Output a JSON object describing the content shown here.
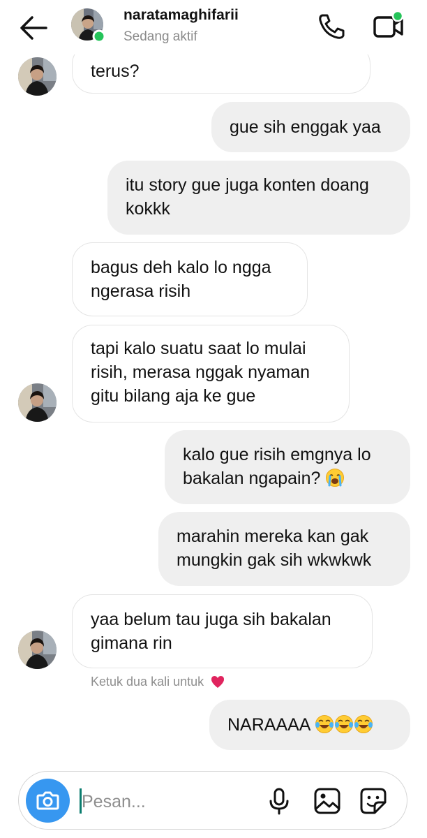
{
  "header": {
    "username": "naratamaghifarii",
    "status": "Sedang aktif",
    "online_color": "#25c45a",
    "icons": [
      "back-arrow-icon",
      "phone-icon",
      "video-camera-icon"
    ]
  },
  "messages": [
    {
      "from": "them",
      "text": "terus?"
    },
    {
      "from": "me",
      "text": "gue sih enggak yaa"
    },
    {
      "from": "me",
      "text": "itu story gue juga konten doang kokkk"
    },
    {
      "from": "them",
      "text": "bagus deh kalo lo ngga ngerasa risih"
    },
    {
      "from": "them",
      "text": "tapi kalo suatu saat lo mulai risih, merasa nggak nyaman gitu bilang aja ke gue"
    },
    {
      "from": "me",
      "text": "kalo gue risih emgnya lo bakalan ngapain?",
      "emoji": "crying-face"
    },
    {
      "from": "me",
      "text": "marahin mereka kan gak mungkin gak sih wkwkwk"
    },
    {
      "from": "them",
      "text": "yaa belum tau juga sih bakalan gimana rin"
    },
    {
      "from": "me",
      "text": "NARAAAA",
      "emoji": "tears-of-joy x3"
    }
  ],
  "hint": {
    "text": "Ketuk dua kali untuk",
    "icon": "heart-icon",
    "heart_color": "#e0245e"
  },
  "composer": {
    "placeholder": "Pesan...",
    "accent": "#3797f0",
    "icons": [
      "camera-icon",
      "microphone-icon",
      "gallery-icon",
      "sticker-icon"
    ]
  }
}
